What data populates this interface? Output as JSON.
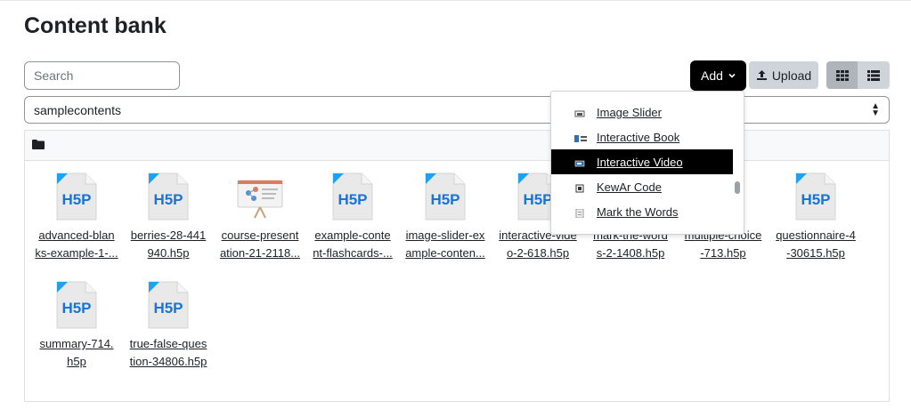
{
  "page": {
    "title": "Content bank"
  },
  "toolbar": {
    "search_placeholder": "Search",
    "add_label": "Add",
    "upload_label": "Upload"
  },
  "context_select": {
    "selected": "samplecontents"
  },
  "files": [
    {
      "line1": "advanced-blan",
      "line2": "ks-example-1-..."
    },
    {
      "line1": "berries-28-441",
      "line2": "940.h5p"
    },
    {
      "line1": "course-present",
      "line2": "ation-21-2118..."
    },
    {
      "line1": "example-conte",
      "line2": "nt-flashcards-..."
    },
    {
      "line1": "image-slider-ex",
      "line2": "ample-conten..."
    },
    {
      "line1": "interactive-vide",
      "line2": "o-2-618.h5p"
    },
    {
      "line1": "mark-the-word",
      "line2": "s-2-1408.h5p"
    },
    {
      "line1": "multiple-choice",
      "line2": "-713.h5p"
    },
    {
      "line1": "questionnaire-4",
      "line2": "-30615.h5p"
    },
    {
      "line1": "summary-714.",
      "line2": "h5p"
    },
    {
      "line1": "true-false-ques",
      "line2": "tion-34806.h5p"
    }
  ],
  "add_menu": {
    "items": [
      {
        "label": "Image Slider",
        "icon": "image-slider-icon"
      },
      {
        "label": "Interactive Book",
        "icon": "book-icon"
      },
      {
        "label": "Interactive Video",
        "icon": "video-icon",
        "active": true
      },
      {
        "label": "KewAr Code",
        "icon": "qr-icon"
      },
      {
        "label": "Mark the Words",
        "icon": "document-icon"
      }
    ]
  },
  "colors": {
    "primary": "#000000",
    "secondary": "#ced4da",
    "h5p_blue": "#1a73d9"
  }
}
